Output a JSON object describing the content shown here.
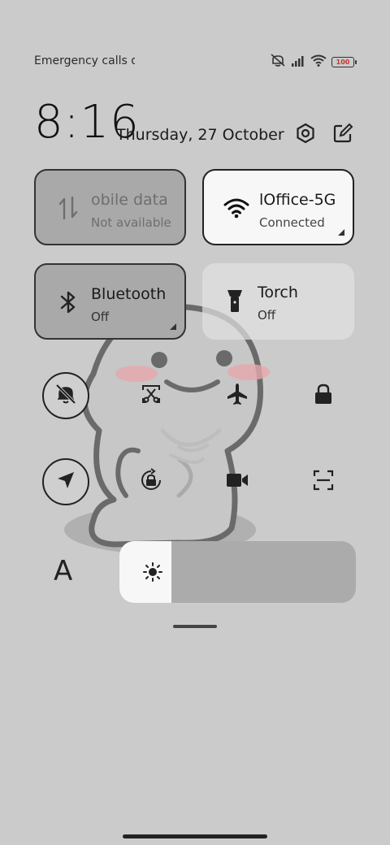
{
  "status_bar": {
    "carrier_text": "Emergency calls o",
    "icons": [
      "mute-icon",
      "signal-icon",
      "wifi-icon",
      "battery-icon"
    ],
    "battery_text": "100"
  },
  "header": {
    "time": "8:16",
    "date": "Thursday, 27 October",
    "settings_icon": "settings-hex-icon",
    "edit_icon": "edit-icon"
  },
  "tiles": [
    {
      "id": "mobile-data",
      "title": "obile data",
      "subtitle": "Not available",
      "icon": "data-arrows-icon",
      "state": "unavailable"
    },
    {
      "id": "wifi",
      "title": "lOffice-5G",
      "subtitle": "Connected",
      "icon": "wifi-icon",
      "state": "on"
    },
    {
      "id": "bluetooth",
      "title": "Bluetooth",
      "subtitle": "Off",
      "icon": "bluetooth-icon",
      "state": "off"
    },
    {
      "id": "torch",
      "title": "Torch",
      "subtitle": "Off",
      "icon": "torch-icon",
      "state": "off"
    }
  ],
  "toggles_row1": [
    {
      "id": "silent",
      "icon": "bell-off-icon",
      "active": true
    },
    {
      "id": "screenshot",
      "icon": "scissors-icon",
      "active": false
    },
    {
      "id": "airplane",
      "icon": "airplane-icon",
      "active": false
    },
    {
      "id": "lock",
      "icon": "lock-icon",
      "active": false
    }
  ],
  "toggles_row2": [
    {
      "id": "location",
      "icon": "location-arrow-icon",
      "active": true
    },
    {
      "id": "rotation-lock",
      "icon": "rotation-lock-icon",
      "active": false
    },
    {
      "id": "screen-record",
      "icon": "video-camera-icon",
      "active": false
    },
    {
      "id": "scanner",
      "icon": "scan-icon",
      "active": false
    }
  ],
  "brightness": {
    "font_label": "A",
    "icon": "sun-icon",
    "level": 0.22
  },
  "colors": {
    "background": "#cbcbcb",
    "tile_active": "#f7f7f7",
    "tile_off": "#a9a9a9",
    "tile_torch": "#dcdcdc"
  }
}
